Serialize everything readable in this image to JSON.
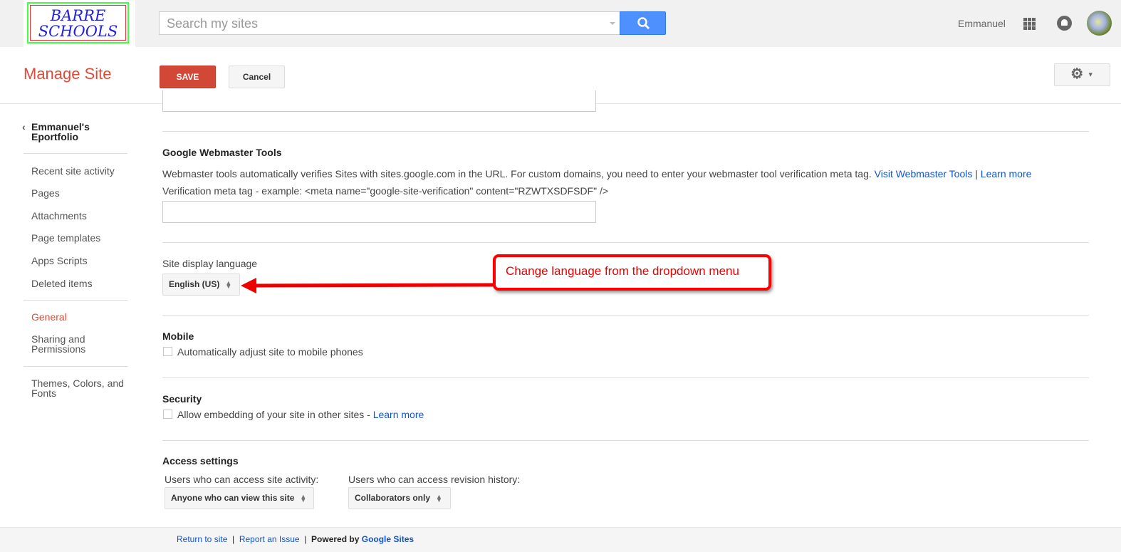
{
  "logo": {
    "text": "BARRE SCHOOLS",
    "line1": "BARRE",
    "line2": "SCHOOLS"
  },
  "search": {
    "placeholder": "Search my sites"
  },
  "user": {
    "name": "Emmanuel"
  },
  "header": {
    "title": "Manage Site",
    "save": "SAVE",
    "cancel": "Cancel"
  },
  "sidebar": {
    "site_name": "Emmanuel's Eportfolio",
    "items": [
      "Recent site activity",
      "Pages",
      "Attachments",
      "Page templates",
      "Apps Scripts",
      "Deleted items"
    ],
    "general": "General",
    "sharing": "Sharing and Permissions",
    "themes": "Themes, Colors, and Fonts"
  },
  "webmaster": {
    "heading": "Google Webmaster Tools",
    "desc": "Webmaster tools automatically verifies Sites with sites.google.com in the URL. For custom domains, you need to enter your webmaster tool verification meta tag.",
    "link1": "Visit Webmaster Tools",
    "sep": "|",
    "link2": "Learn more",
    "example": "Verification meta tag - example: <meta name=\"google-site-verification\" content=\"RZWTXSDFSDF\" />",
    "value": ""
  },
  "language": {
    "label": "Site display language",
    "selected": "English (US)"
  },
  "mobile": {
    "heading": "Mobile",
    "checkbox": "Automatically adjust site to mobile phones",
    "checked": false
  },
  "security": {
    "heading": "Security",
    "checkbox": "Allow embedding of your site in other sites - ",
    "link": "Learn more",
    "checked": false
  },
  "access": {
    "heading": "Access settings",
    "activity_label": "Users who can access site activity:",
    "activity_value": "Anyone who can view this site",
    "revision_label": "Users who can access revision history:",
    "revision_value": "Collaborators only"
  },
  "footer": {
    "return": "Return to site",
    "report": "Report an Issue",
    "powered": "Powered by",
    "google_sites": "Google Sites",
    "sep": "|"
  },
  "annotation": {
    "text": "Change language from the dropdown menu"
  },
  "colors": {
    "accent": "#dd4b39",
    "link": "#1155cc",
    "search": "#4d90fe",
    "annotation": "#ff0000"
  }
}
